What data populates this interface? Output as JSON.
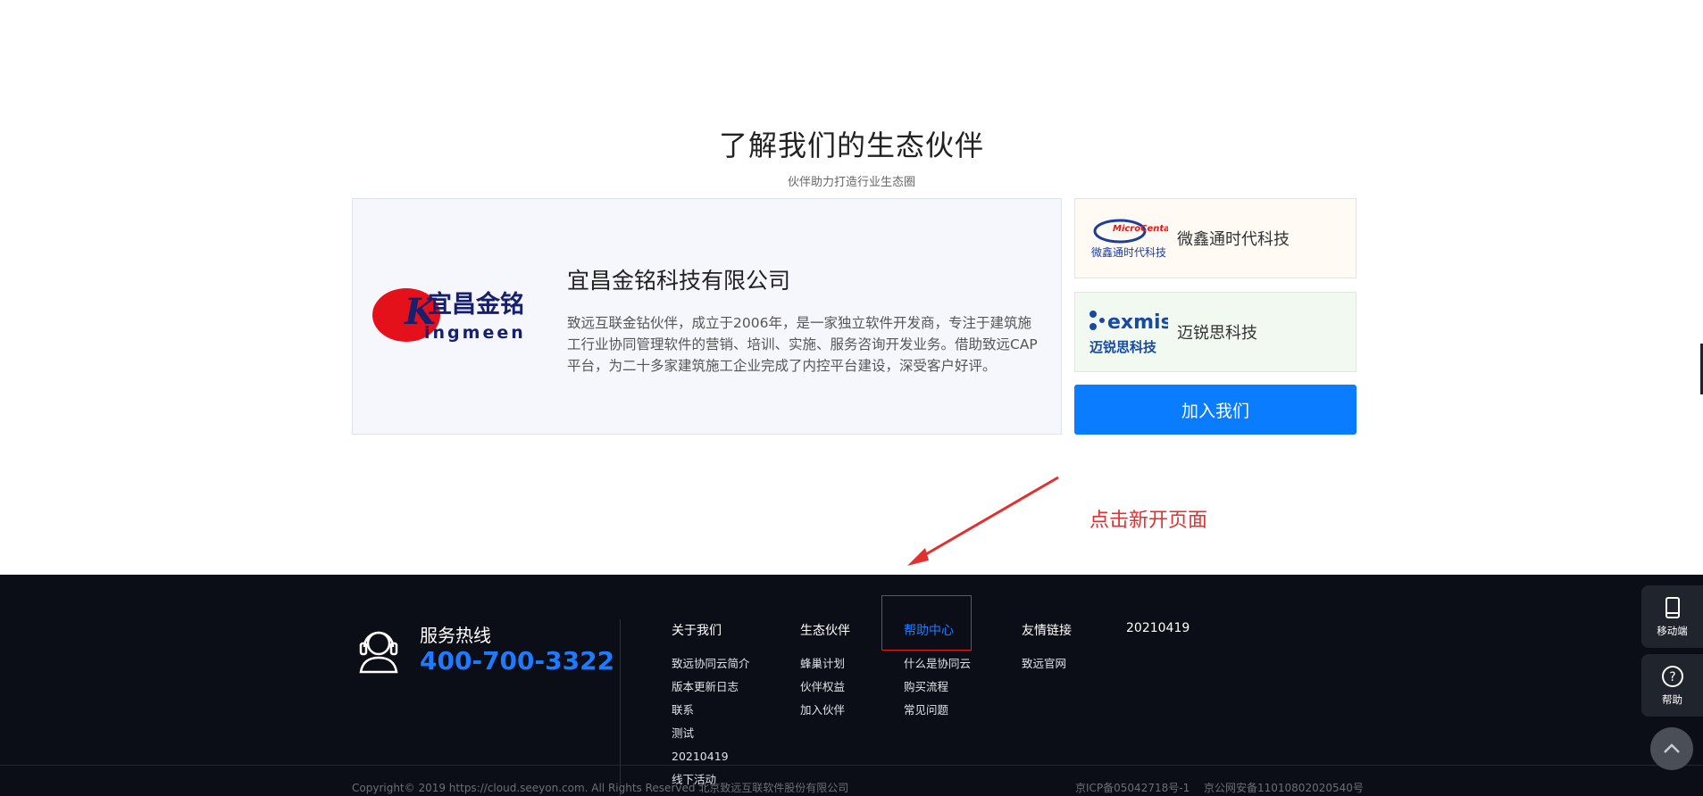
{
  "partners": {
    "title": "了解我们的生态伙伴",
    "subtitle": "伙伴助力打造行业生态圈",
    "featured": {
      "logo_text": "宜昌金铭",
      "logo_sub": "ingmeen",
      "name": "宜昌金铭科技有限公司",
      "description": "致远互联金钻伙伴，成立于2006年，是一家独立软件开发商，专注于建筑施工行业协同管理软件的营销、培训、实施、服务咨询开发业务。借助致远CAP平台，为二十多家建筑施工企业完成了内控平台建设，深受客户好评。"
    },
    "side": [
      {
        "logo_text": "MicroCental",
        "logo_sub": "微鑫通时代科技",
        "name": "微鑫通时代科技"
      },
      {
        "logo_text": "exmis",
        "logo_sub": "迈锐思科技",
        "name": "迈锐思科技"
      }
    ],
    "join_label": "加入我们"
  },
  "annotation": {
    "text": "点击新开页面",
    "color": "#e03030"
  },
  "footer": {
    "hotline_label": "服务热线",
    "hotline_number": "400-700-3322",
    "columns": [
      {
        "title": "关于我们",
        "links": [
          "致远协同云简介",
          "版本更新日志",
          "联系",
          "测试",
          "20210419",
          "线下活动"
        ]
      },
      {
        "title": "生态伙伴",
        "links": [
          "蜂巢计划",
          "伙伴权益",
          "加入伙伴"
        ]
      },
      {
        "title": "帮助中心",
        "links": [
          "什么是协同云",
          "购买流程",
          "常见问题"
        ]
      },
      {
        "title": "友情链接",
        "links": [
          "致远官网"
        ]
      },
      {
        "title": "20210419",
        "links": []
      }
    ],
    "copyright": "Copyright© 2019 https://cloud.seeyon.com. All Rights Reserved 北京致远互联软件股份有限公司",
    "icp": "京ICP备05042718号-1",
    "police": "京公网安备11010802020540号"
  },
  "float": {
    "mobile_label": "移动端",
    "help_label": "帮助"
  },
  "colors": {
    "accent": "#0a7cff",
    "footer_bg": "#0b0e16",
    "link_active": "#1e7bff"
  },
  "icons": [
    "headset-icon",
    "mobile-icon",
    "help-icon",
    "chevron-up-icon"
  ]
}
